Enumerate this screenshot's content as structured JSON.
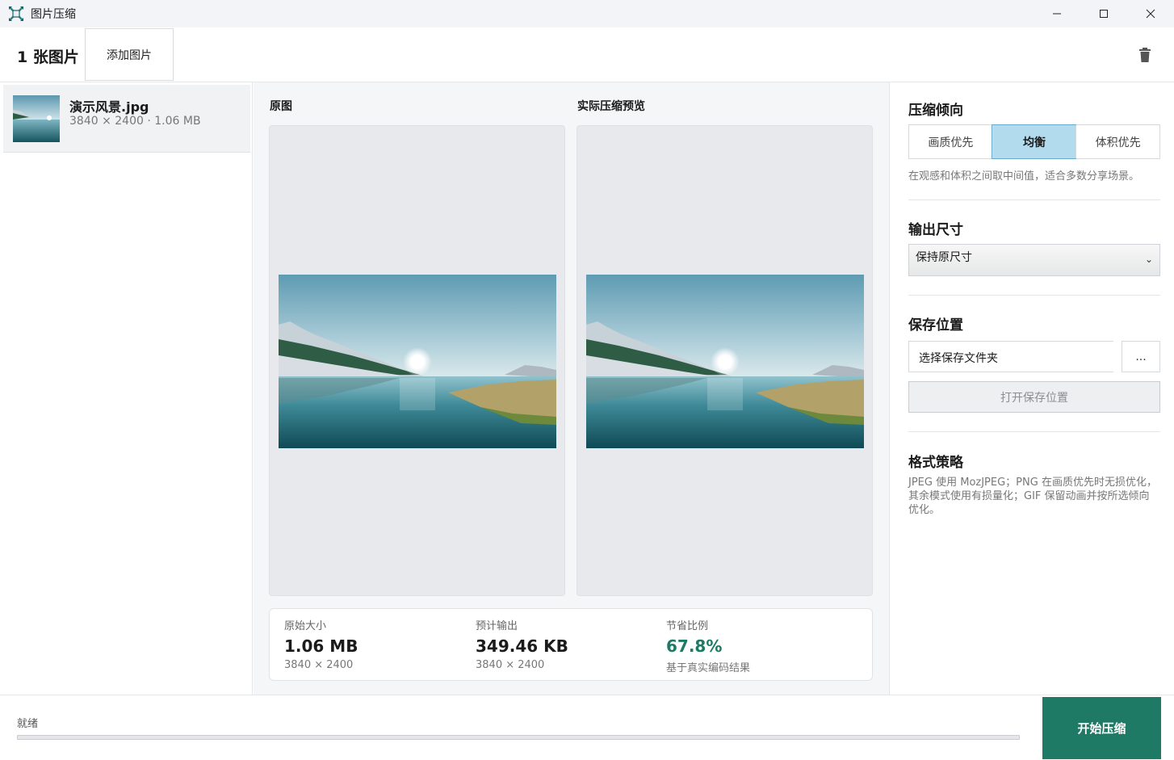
{
  "window": {
    "title": "图片压缩"
  },
  "toolbar": {
    "count_label": "1 张图片",
    "add_label": "添加图片"
  },
  "files": [
    {
      "name": "演示风景.jpg",
      "meta": "3840 × 2400 · 1.06 MB"
    }
  ],
  "preview": {
    "original_label": "原图",
    "compressed_label": "实际压缩预览"
  },
  "stats": {
    "original": {
      "label": "原始大小",
      "value": "1.06 MB",
      "sub": "3840 × 2400"
    },
    "output": {
      "label": "预计输出",
      "value": "349.46 KB",
      "sub": "3840 × 2400"
    },
    "saving": {
      "label": "节省比例",
      "value": "67.8%",
      "sub": "基于真实编码结果"
    }
  },
  "settings": {
    "tendency_title": "压缩倾向",
    "tendency_options": [
      "画质优先",
      "均衡",
      "体积优先"
    ],
    "tendency_selected": "均衡",
    "tendency_hint": "在观感和体积之间取中间值，适合多数分享场景。",
    "size_title": "输出尺寸",
    "size_value": "保持原尺寸",
    "save_title": "保存位置",
    "save_placeholder": "选择保存文件夹",
    "browse_label": "...",
    "open_label": "打开保存位置",
    "format_title": "格式策略",
    "format_text": "JPEG 使用 MozJPEG；PNG 在画质优先时无损优化，其余模式使用有损量化；GIF 保留动画并按所选倾向优化。"
  },
  "status": {
    "text": "就绪",
    "progress": 0,
    "start_label": "开始压缩"
  },
  "colors": {
    "accent": "#1e7a64",
    "selected_segment": "#b3dbee"
  },
  "icons": [
    "app-icon",
    "minimize-icon",
    "maximize-icon",
    "close-icon",
    "trash-icon",
    "chevron-down-icon"
  ]
}
